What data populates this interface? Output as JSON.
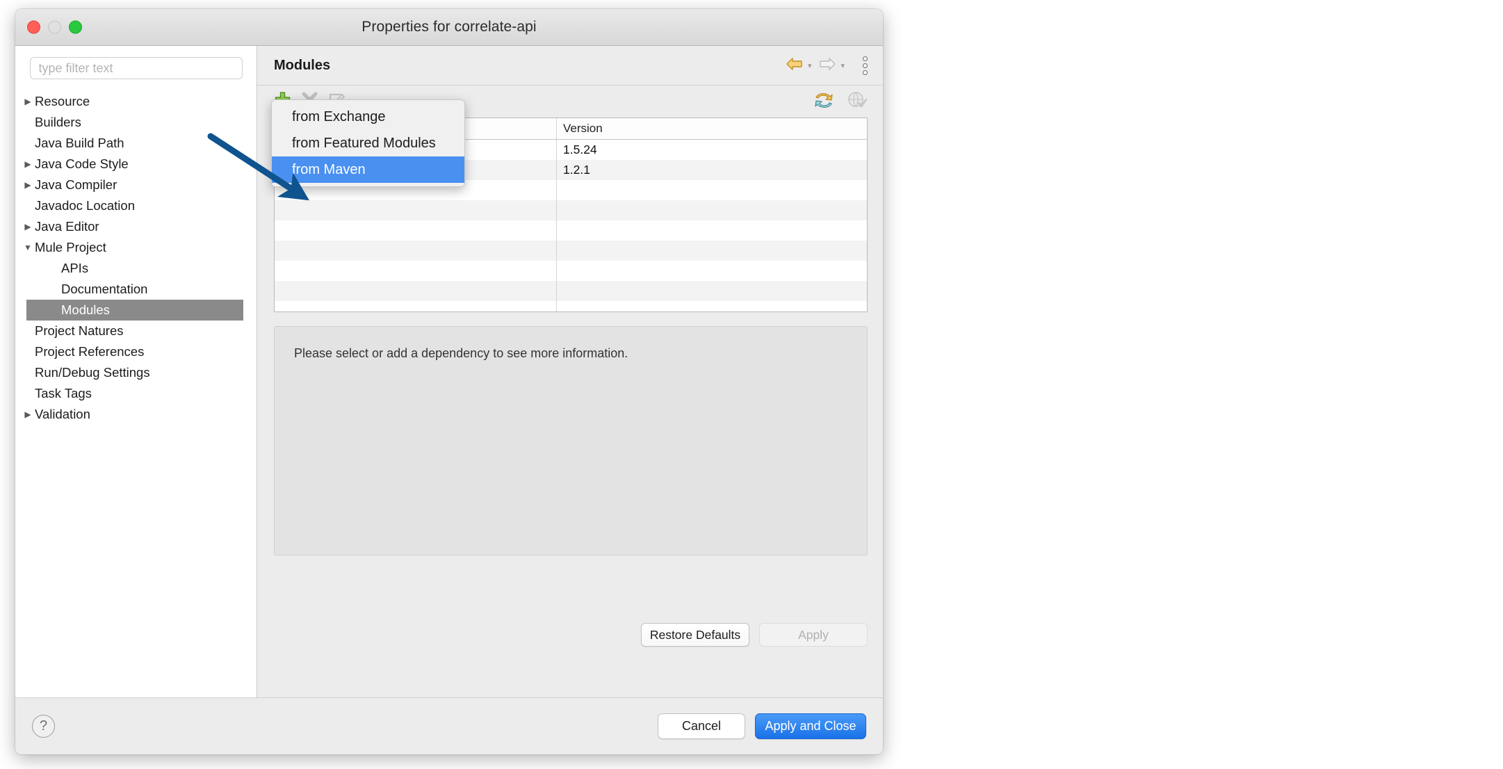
{
  "window": {
    "title": "Properties for correlate-api",
    "controls": [
      {
        "name": "close-button",
        "color": "#ff5f57"
      },
      {
        "name": "minimize-button",
        "color": "#e0e0e0"
      },
      {
        "name": "maximize-button",
        "color": "#28c940"
      }
    ]
  },
  "sidebar": {
    "filter": {
      "value": "",
      "placeholder": "type filter text"
    },
    "items": [
      {
        "label": "Resource",
        "level": 0,
        "twisty": "collapsed",
        "selected": false
      },
      {
        "label": "Builders",
        "level": 0,
        "twisty": "none",
        "selected": false
      },
      {
        "label": "Java Build Path",
        "level": 0,
        "twisty": "none",
        "selected": false
      },
      {
        "label": "Java Code Style",
        "level": 0,
        "twisty": "collapsed",
        "selected": false
      },
      {
        "label": "Java Compiler",
        "level": 0,
        "twisty": "collapsed",
        "selected": false
      },
      {
        "label": "Javadoc Location",
        "level": 0,
        "twisty": "none",
        "selected": false
      },
      {
        "label": "Java Editor",
        "level": 0,
        "twisty": "collapsed",
        "selected": false
      },
      {
        "label": "Mule Project",
        "level": 0,
        "twisty": "expanded",
        "selected": false
      },
      {
        "label": "APIs",
        "level": 1,
        "twisty": "none",
        "selected": false
      },
      {
        "label": "Documentation",
        "level": 1,
        "twisty": "none",
        "selected": false
      },
      {
        "label": "Modules",
        "level": 1,
        "twisty": "none",
        "selected": true
      },
      {
        "label": "Project Natures",
        "level": 0,
        "twisty": "none",
        "selected": false
      },
      {
        "label": "Project References",
        "level": 0,
        "twisty": "none",
        "selected": false
      },
      {
        "label": "Run/Debug Settings",
        "level": 0,
        "twisty": "none",
        "selected": false
      },
      {
        "label": "Task Tags",
        "level": 0,
        "twisty": "none",
        "selected": false
      },
      {
        "label": "Validation",
        "level": 0,
        "twisty": "collapsed",
        "selected": false
      }
    ],
    "selected_index": 10,
    "selection_color": "#8a8a8a"
  },
  "content": {
    "page_title": "Modules",
    "nav": {
      "back_icon": "back-arrow-icon",
      "forward_icon": "forward-arrow-icon",
      "menu_icon": "view-menu-icon",
      "back_enabled": true,
      "forward_enabled": false
    },
    "toolbar": {
      "add_icon": "add-plus-icon",
      "remove_icon": "remove-x-icon",
      "edit_icon": "edit-pencil-icon",
      "refresh_icon": "refresh-sync-icon",
      "validate_icon": "globe-check-icon",
      "add_enabled": true,
      "remove_enabled": false,
      "edit_enabled": false
    },
    "table": {
      "columns": [
        "",
        "Version"
      ],
      "rows": [
        {
          "name": "",
          "version": "1.5.24"
        },
        {
          "name": "",
          "version": "1.2.1"
        },
        {
          "name": "",
          "version": ""
        },
        {
          "name": "",
          "version": ""
        },
        {
          "name": "",
          "version": ""
        },
        {
          "name": "",
          "version": ""
        },
        {
          "name": "",
          "version": ""
        },
        {
          "name": "",
          "version": ""
        },
        {
          "name": "",
          "version": ""
        }
      ]
    },
    "info_text": "Please select or add a dependency to see more information.",
    "restore_defaults_label": "Restore Defaults",
    "apply_label": "Apply",
    "apply_enabled": false
  },
  "add_menu": {
    "visible": true,
    "highlight_color": "#4a90f0",
    "items": [
      {
        "label": "from Exchange",
        "highlighted": false
      },
      {
        "label": "from Featured Modules",
        "highlighted": false
      },
      {
        "label": "from Maven",
        "highlighted": true
      }
    ]
  },
  "footer": {
    "help_icon": "question-mark-icon",
    "cancel_label": "Cancel",
    "apply_and_close_label": "Apply and Close",
    "primary_color": "#1a72e8"
  },
  "annotation": {
    "arrow_color": "#0f538f",
    "points_to": "from Maven"
  }
}
